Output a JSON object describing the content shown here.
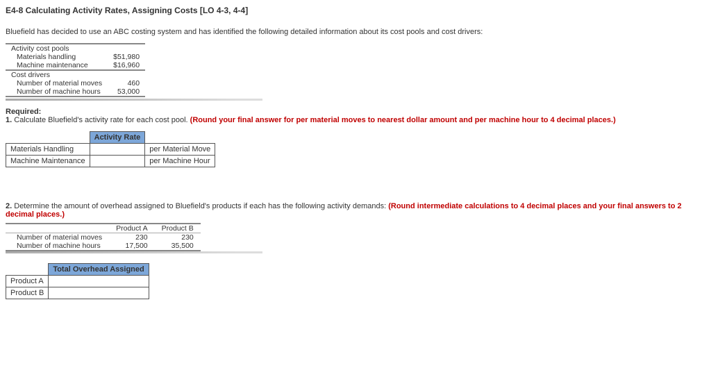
{
  "title": "E4-8 Calculating Activity Rates, Assigning Costs [LO 4-3, 4-4]",
  "intro": "Bluefield has decided to use an ABC costing system and has identified the following detailed information about its cost pools and cost drivers:",
  "info_table": {
    "section1": "Activity cost pools",
    "row1_label": "Materials handling",
    "row1_value": "$51,980",
    "row2_label": "Machine maintenance",
    "row2_value": "$16,960",
    "section2": "Cost drivers",
    "row3_label": "Number of material moves",
    "row3_value": "460",
    "row4_label": "Number of machine hours",
    "row4_value": "53,000"
  },
  "required_label": "Required:",
  "q1": {
    "num": "1.",
    "text": "Calculate Bluefield's activity rate for each cost pool.",
    "instr": "(Round your final answer for per material moves to nearest dollar amount and per machine hour to 4 decimal places.)",
    "header": "Activity Rate",
    "row1_label": "Materials Handling",
    "row1_unit": "per Material Move",
    "row2_label": "Machine Maintenance",
    "row2_unit": "per Machine Hour"
  },
  "q2": {
    "num": "2.",
    "text": "Determine the amount of overhead assigned to Bluefield's products if each has the following activity demands:",
    "instr": "(Round intermediate calculations to 4 decimal places and your final answers to 2 decimal places.)",
    "colA": "Product A",
    "colB": "Product B",
    "row1_label": "Number of material moves",
    "row1_a": "230",
    "row1_b": "230",
    "row2_label": "Number of machine hours",
    "row2_a": "17,500",
    "row2_b": "35,500",
    "overhead_header": "Total Overhead Assigned",
    "prodA": "Product A",
    "prodB": "Product B"
  }
}
